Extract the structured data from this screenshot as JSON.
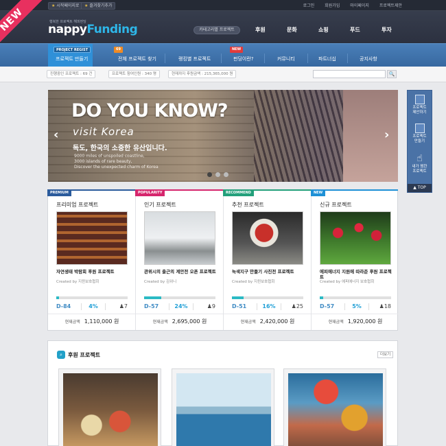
{
  "ribbon": "NEW",
  "util": {
    "home": "시작페이지로",
    "favorite": "즐겨찾기추가"
  },
  "top_links": [
    "로그인",
    "회원가입",
    "마이페이지",
    "프로젝트제안"
  ],
  "logo": {
    "sub": "행복한 프로젝트 해피펀딩",
    "main_a": "nappy",
    "main_b": "Funding"
  },
  "category_button": "카테고리별 프로젝트",
  "main_nav": [
    "후원",
    "문화",
    "쇼핑",
    "푸드",
    "투자"
  ],
  "sub_nav": {
    "active_badge": "PROJECT REGIST",
    "active_label": "프로젝트 만들기",
    "items": [
      {
        "label": "전체 프로젝트 찾기",
        "badge": "69"
      },
      {
        "label": "랭킹별 프로젝트",
        "badge": ""
      },
      {
        "label": "펀딩이란?",
        "badge": "NEW"
      },
      {
        "label": "커뮤니티",
        "badge": ""
      },
      {
        "label": "파트너십",
        "badge": ""
      },
      {
        "label": "공지사항",
        "badge": ""
      }
    ]
  },
  "stats": [
    "진행중인 프로젝트 : 69 건",
    "프로젝트 참여인원 : 340 명",
    "현재까지 후원금액 : 215,365,000 원"
  ],
  "search": {
    "placeholder": "",
    "button": "🔍"
  },
  "banner": {
    "title": "DO YOU KNOW?",
    "visit": "visit Korea",
    "kr": "독도, 한국의 소중한 유산입니다.",
    "en": [
      "9000 miles of unspoiled coastline,",
      "3000 islands of rare beauty,",
      "Discover the unexpected charm of Korea"
    ],
    "prev": "‹",
    "next": "›"
  },
  "quick_menu": {
    "items": [
      "프로젝트\n제안하기",
      "프로젝트\n만들기",
      "내가 찜한\n프로젝트"
    ],
    "top": "▲ TOP"
  },
  "cards": [
    {
      "tag": "PREMIUM",
      "tag_color": "#2b5b9c",
      "title": "프리미엄 프로젝트",
      "name": "자연생태 박람회 후원 프로젝트",
      "by": "Created by 지윈보호협회",
      "progress": 0.04,
      "dday": "D-84",
      "percent": "4%",
      "likes": "♟7",
      "amount_label": "현재금액",
      "amount": "1,110,000 원"
    },
    {
      "tag": "POPULARITY",
      "tag_color": "#d6266d",
      "title": "인기 프로젝트",
      "name": "관위시의 출근의 계안전 오픈 프로젝트",
      "by": "Created by 김위니",
      "progress": 0.24,
      "dday": "D-57",
      "percent": "24%",
      "likes": "♟9",
      "amount_label": "현재금액",
      "amount": "2,695,000 원"
    },
    {
      "tag": "RECOMMEND",
      "tag_color": "#23a07b",
      "title": "추천 프로젝트",
      "name": "녹색지구 만들기 사진전 프로젝트",
      "by": "Created by 지윈보호협회",
      "progress": 0.16,
      "dday": "D-51",
      "percent": "16%",
      "likes": "♟25",
      "amount_label": "현재금액",
      "amount": "2,420,000 원"
    },
    {
      "tag": "NEW",
      "tag_color": "#1e90d6",
      "title": "신규 프로젝트",
      "name": "에피에너지 지원에 따라준 후원 프로젝트",
      "by": "Created by 에피에너지 보호협회",
      "progress": 0.05,
      "dday": "D-57",
      "percent": "5%",
      "likes": "♟18",
      "amount_label": "현재금액",
      "amount": "1,920,000 원"
    }
  ],
  "sponsor": {
    "title": "후원 프로젝트",
    "more": "더보기"
  }
}
